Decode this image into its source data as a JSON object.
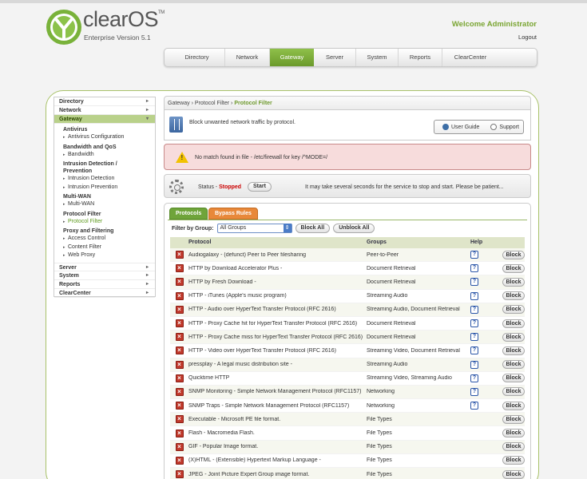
{
  "header": {
    "brand": "clearOS",
    "edition": "Enterprise Version 5.1",
    "welcome": "Welcome Administrator",
    "logout": "Logout"
  },
  "nav": [
    "Directory",
    "Network",
    "Gateway",
    "Server",
    "System",
    "Reports",
    "ClearCenter"
  ],
  "sidebar": {
    "directory": "Directory",
    "network": "Network",
    "gateway": "Gateway",
    "antivirus": "Antivirus",
    "antivirus_config": "Antivirus Configuration",
    "bandwidth_head": "Bandwidth and QoS",
    "bandwidth": "Bandwidth",
    "intrusion_head1": "Intrusion Detection /",
    "intrusion_head2": "Prevention",
    "intrusion_detection": "Intrusion Detection",
    "intrusion_prevention": "Intrusion Prevention",
    "multiwan_head": "Multi-WAN",
    "multiwan": "Multi-WAN",
    "protocol_filter_head": "Protocol Filter",
    "protocol_filter": "Protocol Filter",
    "proxy_head": "Proxy and Filtering",
    "access_control": "Access Control",
    "content_filter": "Content Filter",
    "web_proxy": "Web Proxy",
    "server": "Server",
    "system": "System",
    "reports": "Reports",
    "clearcenter": "ClearCenter"
  },
  "breadcrumb": {
    "part1": "Gateway",
    "sep": "›",
    "part2": "Protocol Filter",
    "current": "Protocol Filter"
  },
  "summary": {
    "text": "Block unwanted network traffic by protocol.",
    "user_guide": "User Guide",
    "support": "Support"
  },
  "error": {
    "text": "No match found in file - /etc/firewall for key /^MODE=/"
  },
  "status": {
    "label": "Status - ",
    "value": "Stopped",
    "start": "Start",
    "message": "It may take several seconds for the service to stop and start.  Please be patient..."
  },
  "tabs": {
    "protocols": "Protocols",
    "bypass": "Bypass Rules"
  },
  "filter": {
    "label": "Filter by Group:",
    "selected": "All Groups",
    "block_all": "Block All",
    "unblock_all": "Unblock All"
  },
  "table": {
    "headers": {
      "protocol": "Protocol",
      "groups": "Groups",
      "help": "Help"
    },
    "block_label": "Block",
    "rows": [
      {
        "protocol": "Audiogalaxy - (defunct) Peer to Peer filesharing",
        "groups": "Peer-to-Peer",
        "help": true
      },
      {
        "protocol": "HTTP by Download Accelerator Plus -",
        "groups": "Document Retrieval",
        "help": true
      },
      {
        "protocol": "HTTP by Fresh Download -",
        "groups": "Document Retrieval",
        "help": true
      },
      {
        "protocol": "HTTP - iTunes (Apple's music program)",
        "groups": "Streaming Audio",
        "help": true
      },
      {
        "protocol": "HTTP - Audio over HyperText Transfer Protocol (RFC 2616)",
        "groups": "Streaming Audio, Document Retrieval",
        "help": true
      },
      {
        "protocol": "HTTP - Proxy Cache hit for HyperText Transfer Protocol (RFC 2616)",
        "groups": "Document Retrieval",
        "help": true
      },
      {
        "protocol": "HTTP - Proxy Cache miss for HyperText Transfer Protocol (RFC 2616)",
        "groups": "Document Retrieval",
        "help": true
      },
      {
        "protocol": "HTTP - Video over HyperText Transfer Protocol (RFC 2616)",
        "groups": "Streaming Video, Document Retrieval",
        "help": true
      },
      {
        "protocol": "pressplay - A legal music distribution site -",
        "groups": "Streaming Audio",
        "help": true
      },
      {
        "protocol": "Quicktime HTTP",
        "groups": "Streaming Video, Streaming Audio",
        "help": true
      },
      {
        "protocol": "SNMP Monitoring - Simple Network Management Protocol (RFC1157)",
        "groups": "Networking",
        "help": true
      },
      {
        "protocol": "SNMP Traps - Simple Network Management Protocol (RFC1157)",
        "groups": "Networking",
        "help": true
      },
      {
        "protocol": "Executable - Microsoft PE file format.",
        "groups": "File Types",
        "help": false
      },
      {
        "protocol": "Flash - Macromedia Flash.",
        "groups": "File Types",
        "help": false
      },
      {
        "protocol": "GIF - Popular Image format.",
        "groups": "File Types",
        "help": false
      },
      {
        "protocol": "(X)HTML - (Extensible) Hypertext Markup Language -",
        "groups": "File Types",
        "help": false
      },
      {
        "protocol": "JPEG - Joint Picture Expert Group image format.",
        "groups": "File Types",
        "help": false
      }
    ]
  }
}
